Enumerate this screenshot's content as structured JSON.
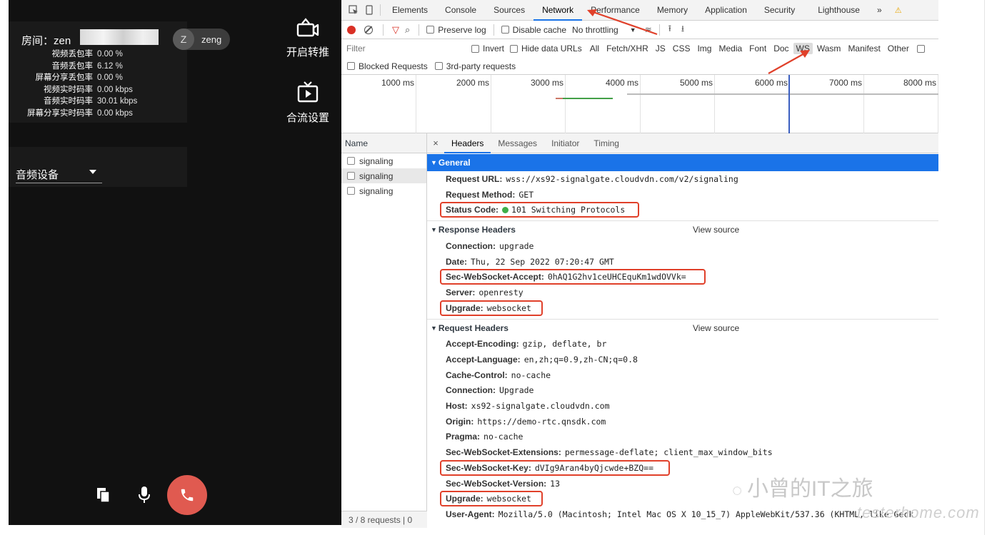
{
  "app": {
    "room_label": "房间：zen",
    "user": {
      "initial": "Z",
      "name": "zeng"
    },
    "stats": [
      {
        "label": "视频丢包率",
        "value": "0.00 %"
      },
      {
        "label": "音频丢包率",
        "value": "6.12 %"
      },
      {
        "label": "屏幕分享丢包率",
        "value": "0.00 %"
      },
      {
        "label": "视频实时码率",
        "value": "0.00 kbps"
      },
      {
        "label": "音频实时码率",
        "value": "30.01 kbps"
      },
      {
        "label": "屏幕分享实时码率",
        "value": "0.00 kbps"
      }
    ],
    "actions": {
      "push": "开启转推",
      "merge": "合流设置"
    },
    "device_select": "音频设备",
    "icons": [
      "camera-icon",
      "tv-icon",
      "copy-icon",
      "mic-icon",
      "phone-icon"
    ],
    "hangup_color": "#e05a50"
  },
  "devtools": {
    "tabs": [
      "Elements",
      "Console",
      "Sources",
      "Network",
      "Performance",
      "Memory",
      "Application",
      "Security",
      "Lighthouse",
      "»"
    ],
    "active_tab": "Network",
    "toolbar": {
      "preserve_log": "Preserve log",
      "disable_cache": "Disable cache",
      "throttling": "No throttling"
    },
    "filter": {
      "placeholder": "Filter",
      "invert": "Invert",
      "hide_data_urls": "Hide data URLs",
      "types": [
        "All",
        "Fetch/XHR",
        "JS",
        "CSS",
        "Img",
        "Media",
        "Font",
        "Doc",
        "WS",
        "Wasm",
        "Manifest",
        "Other"
      ],
      "active_type": "WS",
      "blocked_requests": "Blocked Requests",
      "third_party": "3rd-party requests"
    },
    "timeline_ticks": [
      "1000 ms",
      "2000 ms",
      "3000 ms",
      "4000 ms",
      "5000 ms",
      "6000 ms",
      "7000 ms",
      "8000 ms"
    ],
    "requests": {
      "column": "Name",
      "items": [
        "signaling",
        "signaling",
        "signaling"
      ],
      "footer": "3 / 8 requests  |  0"
    },
    "detail_tabs": [
      "Headers",
      "Messages",
      "Initiator",
      "Timing"
    ],
    "general": {
      "title": "General",
      "rows": [
        {
          "k": "Request URL:",
          "v": "wss://xs92-signalgate.cloudvdn.com/v2/signaling"
        },
        {
          "k": "Request Method:",
          "v": "GET"
        },
        {
          "k": "Status Code:",
          "v": "101 Switching Protocols"
        }
      ]
    },
    "response_headers": {
      "title": "Response Headers",
      "view_source": "View source",
      "rows": [
        {
          "k": "Connection:",
          "v": "upgrade"
        },
        {
          "k": "Date:",
          "v": "Thu, 22 Sep 2022 07:20:47 GMT"
        },
        {
          "k": "Sec-WebSocket-Accept:",
          "v": "0hAQ1G2hv1ceUHCEquKm1wdOVVk="
        },
        {
          "k": "Server:",
          "v": "openresty"
        },
        {
          "k": "Upgrade:",
          "v": "websocket"
        }
      ]
    },
    "request_headers": {
      "title": "Request Headers",
      "view_source": "View source",
      "rows": [
        {
          "k": "Accept-Encoding:",
          "v": "gzip, deflate, br"
        },
        {
          "k": "Accept-Language:",
          "v": "en,zh;q=0.9,zh-CN;q=0.8"
        },
        {
          "k": "Cache-Control:",
          "v": "no-cache"
        },
        {
          "k": "Connection:",
          "v": "Upgrade"
        },
        {
          "k": "Host:",
          "v": "xs92-signalgate.cloudvdn.com"
        },
        {
          "k": "Origin:",
          "v": "https://demo-rtc.qnsdk.com"
        },
        {
          "k": "Pragma:",
          "v": "no-cache"
        },
        {
          "k": "Sec-WebSocket-Extensions:",
          "v": "permessage-deflate; client_max_window_bits"
        },
        {
          "k": "Sec-WebSocket-Key:",
          "v": "dVIg9Aran4byQjcwde+BZQ=="
        },
        {
          "k": "Sec-WebSocket-Version:",
          "v": "13"
        },
        {
          "k": "Upgrade:",
          "v": "websocket"
        },
        {
          "k": "User-Agent:",
          "v": "Mozilla/5.0 (Macintosh; Intel Mac OS X 10_15_7) AppleWebKit/537.36 (KHTML, like Geck"
        }
      ]
    },
    "highlight_color": "#e0402a",
    "accent_color": "#1a73e8"
  },
  "watermark": {
    "main": "小曾的IT之旅",
    "site": "testerhome.com"
  }
}
